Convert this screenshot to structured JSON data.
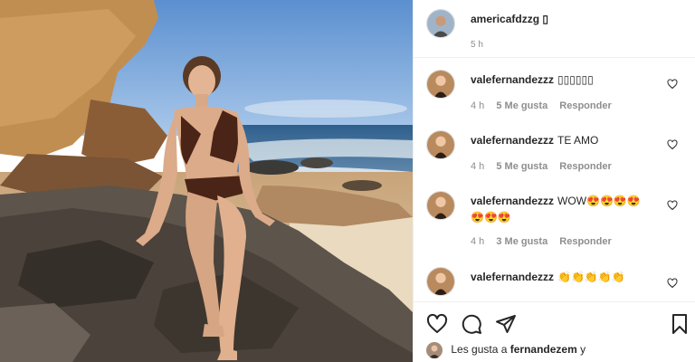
{
  "post": {
    "owner": "americafdzzg",
    "owner_suffix": "▯",
    "time": "5 h"
  },
  "comments": [
    {
      "user": "valefernandezzz",
      "text": "▯▯▯▯▯▯",
      "time": "4 h",
      "likes": "5 Me gusta",
      "reply": "Responder"
    },
    {
      "user": "valefernandezzz",
      "text": "TE AMO",
      "time": "4 h",
      "likes": "5 Me gusta",
      "reply": "Responder"
    },
    {
      "user": "valefernandezzz",
      "text": "WOW😍😍😍😍😍😍😍",
      "time": "4 h",
      "likes": "3 Me gusta",
      "reply": "Responder"
    },
    {
      "user": "valefernandezzz",
      "text": "👏👏👏👏👏",
      "time": "",
      "likes": "",
      "reply": ""
    }
  ],
  "actions": {
    "like_icon": "heart-icon",
    "comment_icon": "comment-icon",
    "share_icon": "send-icon",
    "save_icon": "bookmark-icon"
  },
  "liked_by": {
    "prefix": "Les gusta a",
    "user": "fernandezem",
    "suffix": "y"
  },
  "colors": {
    "text": "#262626",
    "secondary": "#8e8e8e",
    "border": "#efefef"
  }
}
